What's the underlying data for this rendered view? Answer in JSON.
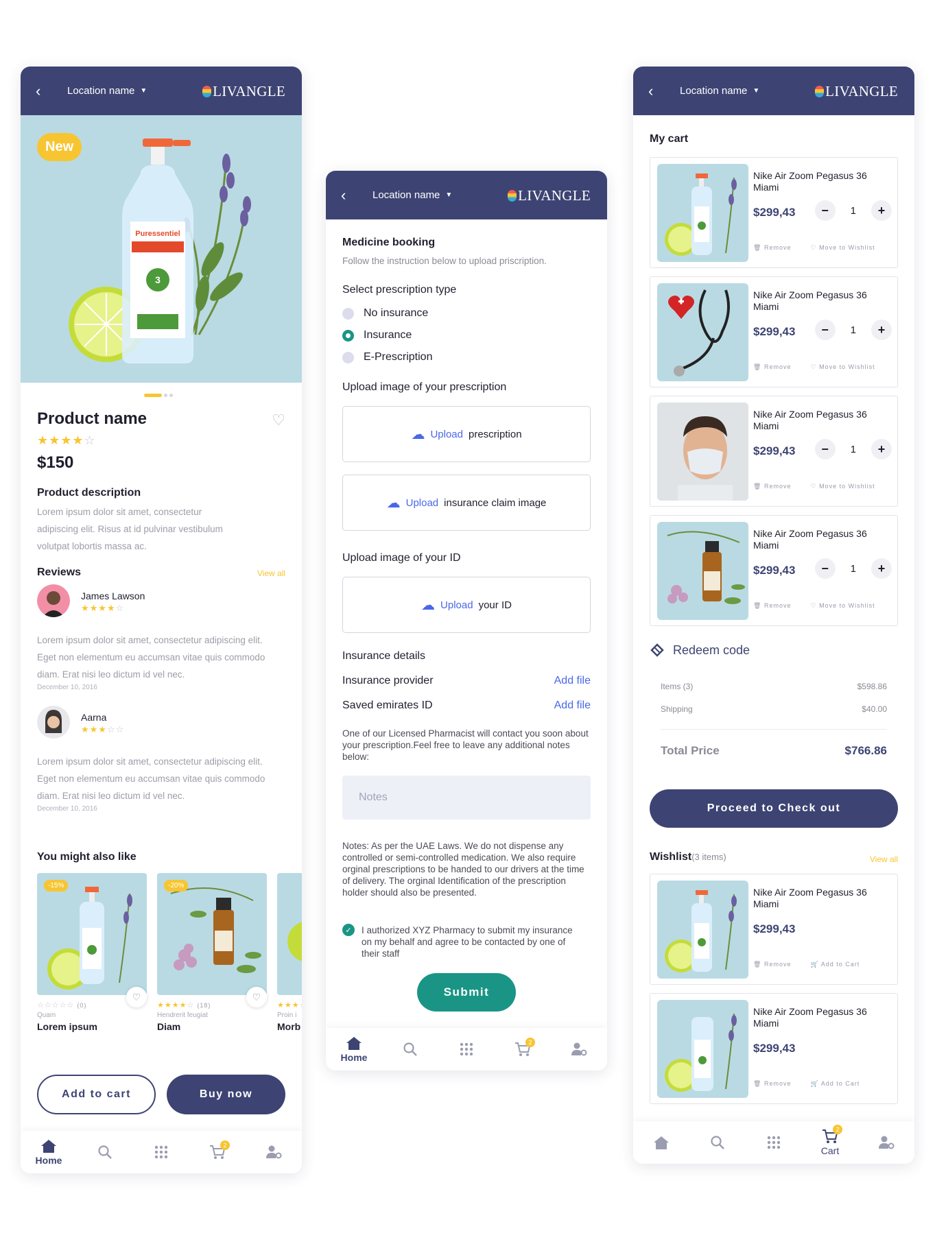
{
  "common": {
    "location": "Location name",
    "logo": "LIVANGLE",
    "nav": {
      "home": "Home",
      "cart": "Cart",
      "cart_badge": "2"
    }
  },
  "product": {
    "badge": "New",
    "name": "Product name",
    "rating": 4,
    "price": "$150",
    "desc_title": "Product description",
    "desc": "Lorem ipsum dolor sit amet, consectetur adipiscing elit. Risus at id pulvinar vestibulum volutpat lobortis massa ac.",
    "reviews_title": "Reviews",
    "view_all": "View all",
    "reviews": [
      {
        "name": "James Lawson",
        "rating": 4,
        "text": "Lorem ipsum dolor sit amet, consectetur adipiscing elit. Eget non elementum eu accumsan vitae quis commodo diam. Erat nisi leo dictum id vel nec.",
        "date": "December 10, 2016"
      },
      {
        "name": "Aarna",
        "rating": 3,
        "text": "Lorem ipsum dolor sit amet, consectetur adipiscing elit. Eget non elementum eu accumsan vitae quis commodo diam. Erat nisi leo dictum id vel nec.",
        "date": "December 10, 2016"
      }
    ],
    "similar_title": "You might also like",
    "similar": [
      {
        "discount": "-15%",
        "rating": 0,
        "count": "(0)",
        "sub": "Quam",
        "title": "Lorem ipsum"
      },
      {
        "discount": "-20%",
        "rating": 4,
        "count": "(18)",
        "sub": "Hendrerit feugiat",
        "title": "Diam"
      },
      {
        "discount": "",
        "rating": 3,
        "count": "",
        "sub": "Proin i",
        "title": "Morb"
      }
    ],
    "add_to_cart": "Add to cart",
    "buy_now": "Buy now"
  },
  "booking": {
    "title": "Medicine booking",
    "subtitle": "Follow the instruction below to upload priscription.",
    "type_title": "Select prescription type",
    "types": [
      "No insurance",
      "Insurance",
      "E-Prescription"
    ],
    "selected_type": "Insurance",
    "upload_title": "Upload image of your prescription",
    "upload_word": "Upload",
    "upload_prescription": "prescription",
    "upload_claim": "insurance claim image",
    "id_title": "Upload image of your ID",
    "upload_id": "your ID",
    "ins_title": "Insurance details",
    "ins_provider": "Insurance provider",
    "saved_id": "Saved emirates ID",
    "add_file": "Add file",
    "contact_note": "One of our Licensed Pharmacist will contact you soon about your prescription.Feel free to leave any additional notes below:",
    "notes_placeholder": "Notes",
    "law_note": "Notes: As per the UAE Laws. We do not dispense any controlled or semi-controlled medication. We also require orginal prescriptions to be handed to our drivers at the time of delivery. The orginal Identification of the prescription holder should also be presented.",
    "authorize": "I authorized XYZ Pharmacy to submit my insurance on my behalf and agree to be contacted by one of their staff",
    "submit": "Submit"
  },
  "cart": {
    "title": "My cart",
    "remove": "Remove",
    "move_wishlist": "Move to Wishlist",
    "add_cart": "Add to Cart",
    "items": [
      {
        "name": "Nike Air Zoom Pegasus 36 Miami",
        "price": "$299,43",
        "qty": "1",
        "image": "sanitizer"
      },
      {
        "name": "Nike Air Zoom Pegasus 36 Miami",
        "price": "$299,43",
        "qty": "1",
        "image": "stethoscope"
      },
      {
        "name": "Nike Air Zoom Pegasus 36 Miami",
        "price": "$299,43",
        "qty": "1",
        "image": "mask"
      },
      {
        "name": "Nike Air Zoom Pegasus 36 Miami",
        "price": "$299,43",
        "qty": "1",
        "image": "oil"
      }
    ],
    "redeem": "Redeem code",
    "items_label": "Items (3)",
    "items_value": "$598.86",
    "shipping_label": "Shipping",
    "shipping_value": "$40.00",
    "total_label": "Total Price",
    "total_value": "$766.86",
    "checkout": "Proceed to Check out",
    "wishlist_title": "Wishlist",
    "wishlist_count": "(3 items)",
    "view_all": "View all",
    "wishlist": [
      {
        "name": "Nike Air Zoom Pegasus 36 Miami",
        "price": "$299,43"
      },
      {
        "name": "Nike Air Zoom Pegasus 36 Miami",
        "price": "$299,43"
      }
    ]
  },
  "colors": {
    "primary": "#3d4473",
    "accent": "#f7c531",
    "teal": "#1a9585",
    "link": "#4a67e8",
    "image_bg": "#b9dae3"
  }
}
